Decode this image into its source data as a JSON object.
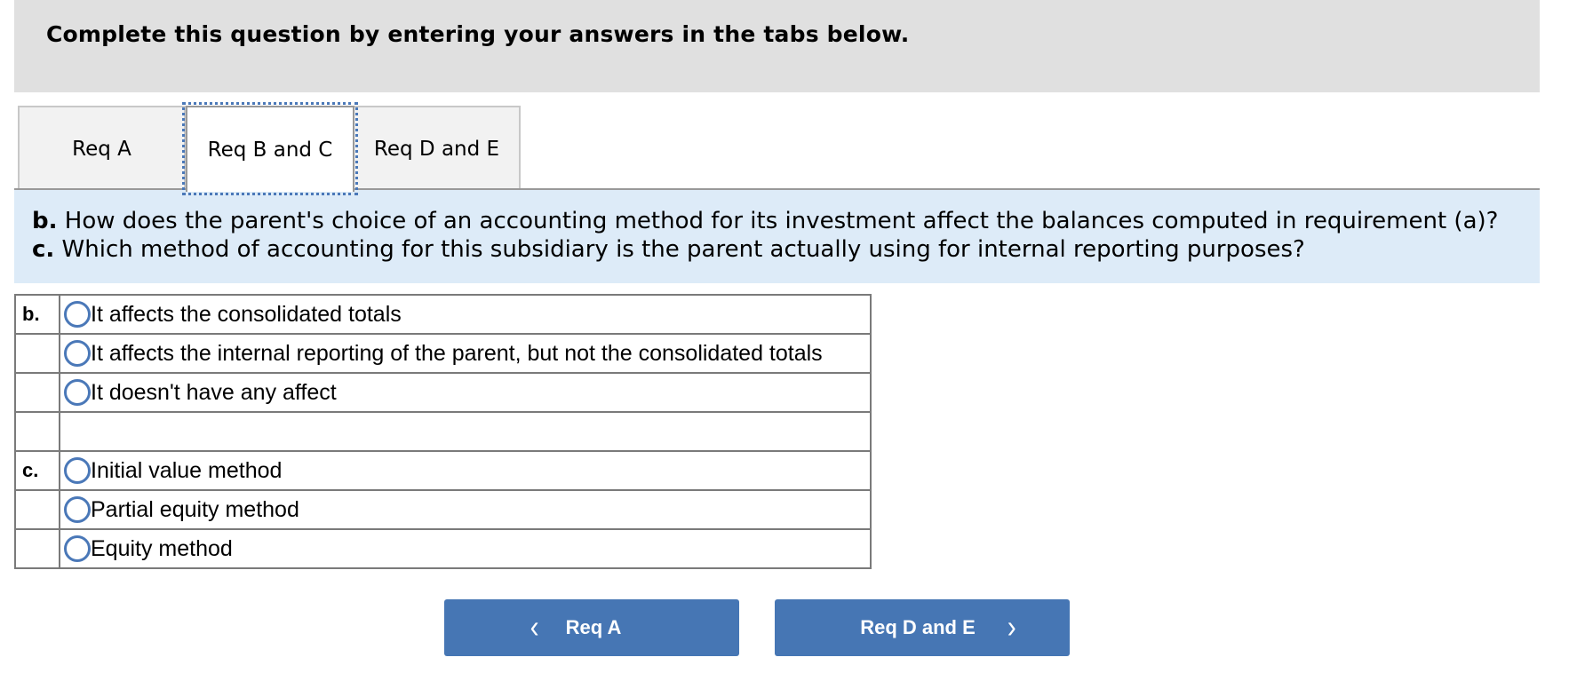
{
  "instruction": "Complete this question by entering your answers in the tabs below.",
  "tabs": [
    {
      "label": "Req A",
      "active": false
    },
    {
      "label": "Req B and C",
      "active": true
    },
    {
      "label": "Req D and E",
      "active": false
    }
  ],
  "questions": {
    "b": {
      "letter": "b.",
      "text": " How does the parent's choice of an accounting method for its investment affect the balances computed in requirement (a)?"
    },
    "c": {
      "letter": "c.",
      "text": " Which method of accounting for this subsidiary is the parent actually using for internal reporting purposes?"
    }
  },
  "answers": {
    "b": {
      "label": "b.",
      "options": [
        "It affects the consolidated totals",
        "It affects the internal reporting of the parent, but not the consolidated totals",
        "It doesn't have any affect"
      ]
    },
    "c": {
      "label": "c.",
      "options": [
        "Initial value method",
        "Partial equity method",
        "Equity method"
      ]
    }
  },
  "navigation": {
    "prev_label": "Req A",
    "prev_icon": "‹",
    "next_label": "Req D and E",
    "next_icon": "›"
  },
  "colors": {
    "accent": "#4676b4",
    "instruction_bg": "#e0e0e0",
    "question_bg": "#ddebf8"
  }
}
